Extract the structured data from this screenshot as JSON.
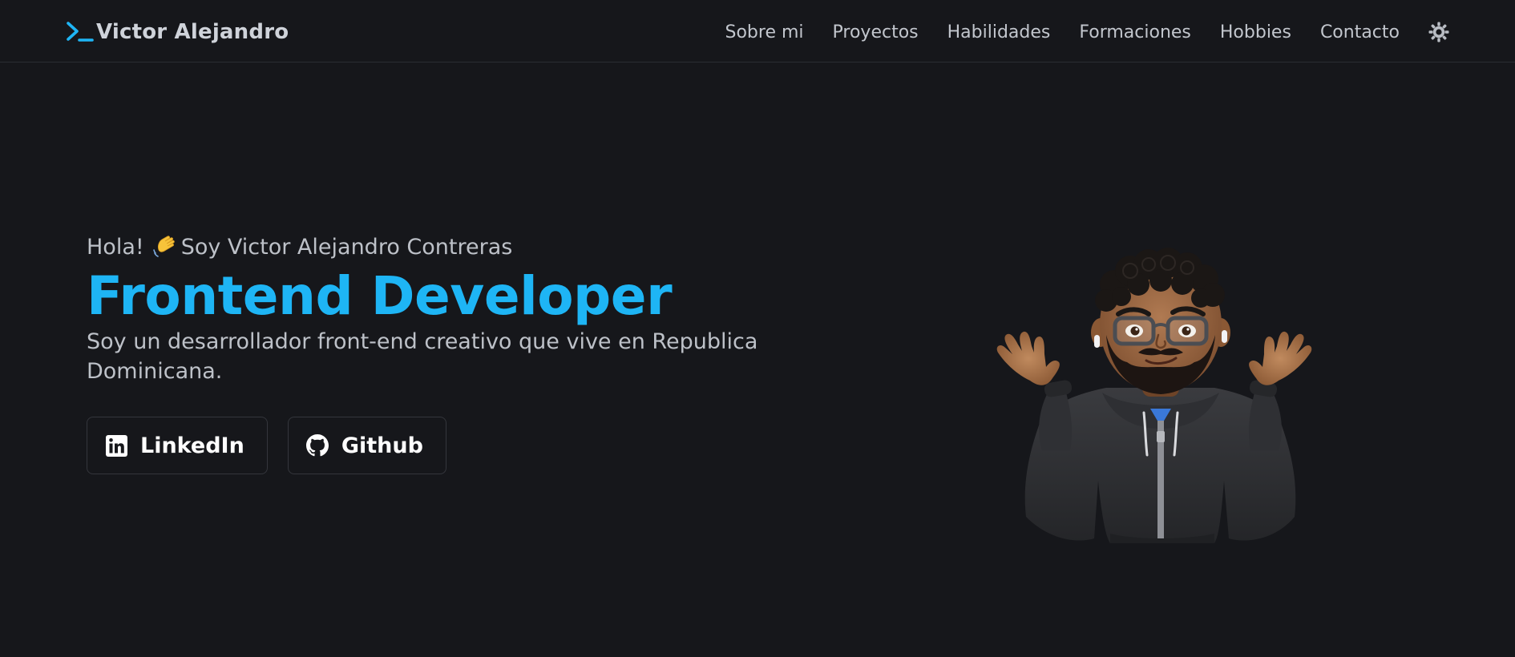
{
  "header": {
    "brand": "Victor Alejandro",
    "brand_icon": "terminal-prompt-icon",
    "nav": [
      {
        "label": "Sobre mi"
      },
      {
        "label": "Proyectos"
      },
      {
        "label": "Habilidades"
      },
      {
        "label": "Formaciones"
      },
      {
        "label": "Hobbies"
      },
      {
        "label": "Contacto"
      }
    ],
    "theme_icon": "sun-icon"
  },
  "hero": {
    "greeting_prefix": "Hola!",
    "greeting_name": "Soy Victor Alejandro Contreras",
    "role": "Frontend Developer",
    "tagline": "Soy un desarrollador front-end creativo que vive en Republica Dominicana.",
    "buttons": [
      {
        "label": "LinkedIn",
        "icon": "linkedin-icon"
      },
      {
        "label": "Github",
        "icon": "github-icon"
      }
    ],
    "avatar": "memoji-shrug-avatar"
  },
  "colors": {
    "background": "#16171b",
    "accent": "#1eb5f5",
    "text": "#c2c6cd"
  }
}
